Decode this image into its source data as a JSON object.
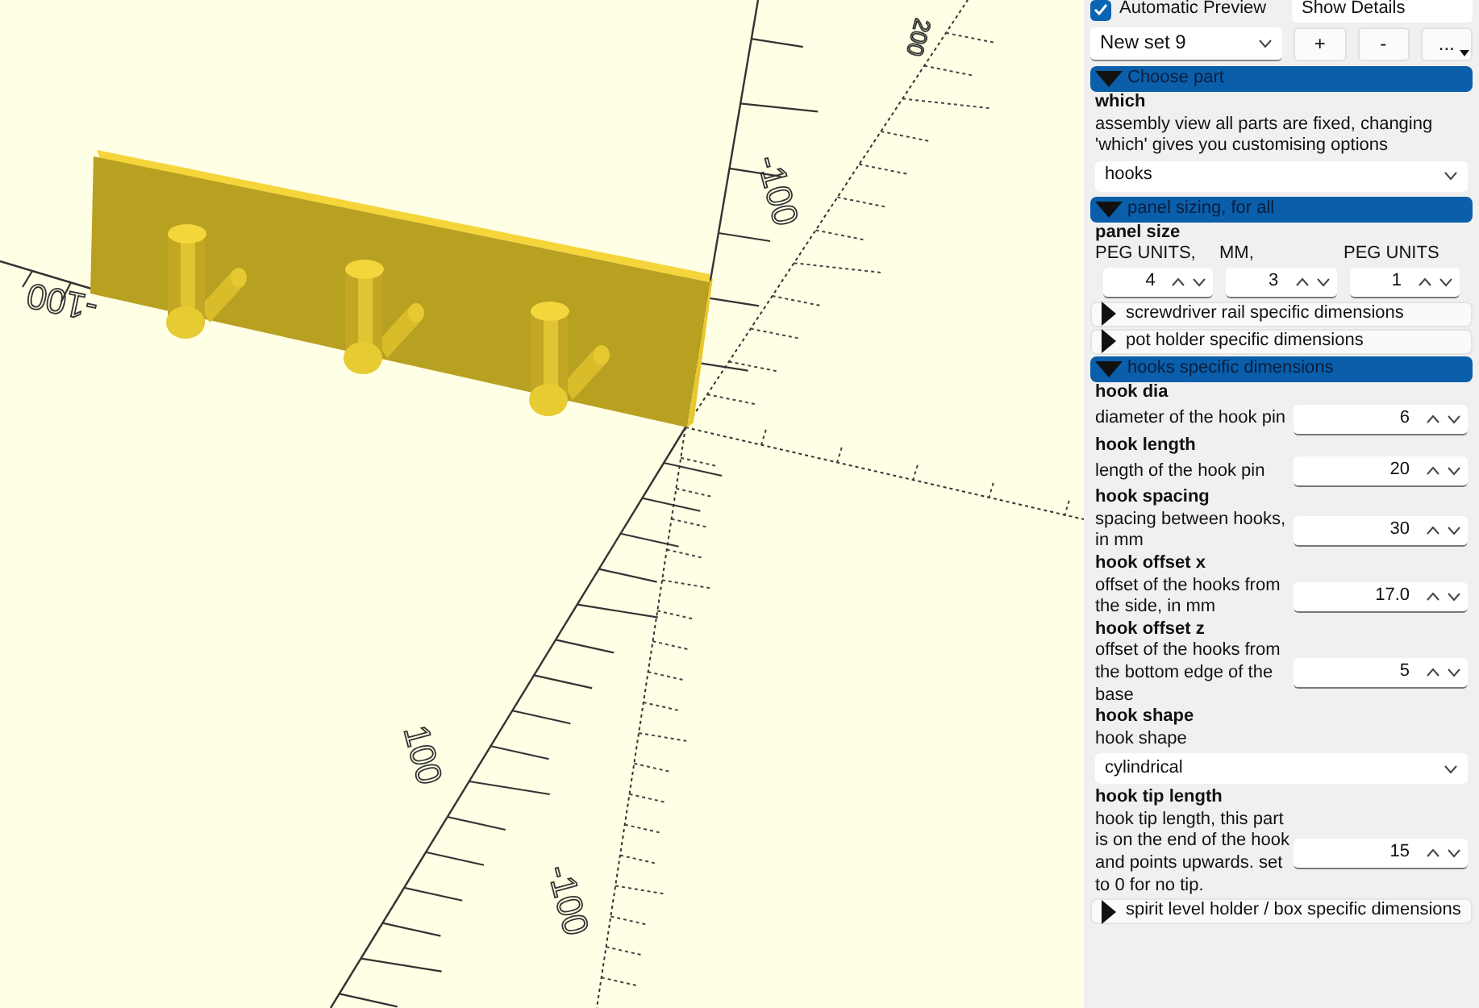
{
  "viewport": {
    "axis_labels": [
      {
        "text": "200",
        "kind": "z-top"
      },
      {
        "text": "-100",
        "kind": "z-mid"
      },
      {
        "text": "-100",
        "kind": "x-left"
      },
      {
        "text": "100",
        "kind": "y-near"
      },
      {
        "text": "-100",
        "kind": "y-far"
      }
    ]
  },
  "preview_bar": {
    "automatic_preview": {
      "label": "Automatic Preview",
      "checked": true
    },
    "view_mode": "Show Details"
  },
  "preset_bar": {
    "preset": "New set 9",
    "buttons": [
      "+",
      "-",
      "..."
    ]
  },
  "sections": [
    {
      "title": "Choose part",
      "expanded": true,
      "params": [
        {
          "kind": "dropdown",
          "name": "which",
          "description": "assembly view all parts are fixed, changing 'which' gives you customising options",
          "value": "hooks"
        }
      ]
    },
    {
      "title": "panel sizing, for all",
      "expanded": true,
      "params": [
        {
          "kind": "vector",
          "name": "panel size",
          "labels": [
            "PEG UNITS,",
            "MM,",
            "PEG UNITS"
          ],
          "values": [
            "4",
            "3",
            "1"
          ]
        }
      ]
    },
    {
      "title": "screwdriver rail specific dimensions",
      "expanded": false
    },
    {
      "title": "pot holder specific dimensions",
      "expanded": false
    },
    {
      "title": "hooks specific dimensions",
      "expanded": true,
      "params": [
        {
          "kind": "spinbox",
          "name": "hook dia",
          "description": "diameter of the hook pin",
          "value": "6"
        },
        {
          "kind": "spinbox",
          "name": "hook length",
          "description": "length of the hook pin",
          "value": "20"
        },
        {
          "kind": "spinbox",
          "name": "hook spacing",
          "description": "spacing between hooks, in mm",
          "value": "30"
        },
        {
          "kind": "spinbox",
          "name": "hook offset x",
          "description": "offset of the hooks from the side, in mm",
          "value": "17.0"
        },
        {
          "kind": "spinbox",
          "name": "hook offset z",
          "description": "offset of the hooks from the bottom edge of the base",
          "value": "5"
        },
        {
          "kind": "dropdown",
          "name": "hook shape",
          "description": "hook shape",
          "value": "cylindrical"
        },
        {
          "kind": "spinbox",
          "name": "hook tip length",
          "description": "hook tip length, this part is on the end of the hook and points upwards. set to 0 for no tip.",
          "value": "15"
        }
      ]
    },
    {
      "title": "spirit level holder / box specific dimensions",
      "expanded": false
    }
  ]
}
